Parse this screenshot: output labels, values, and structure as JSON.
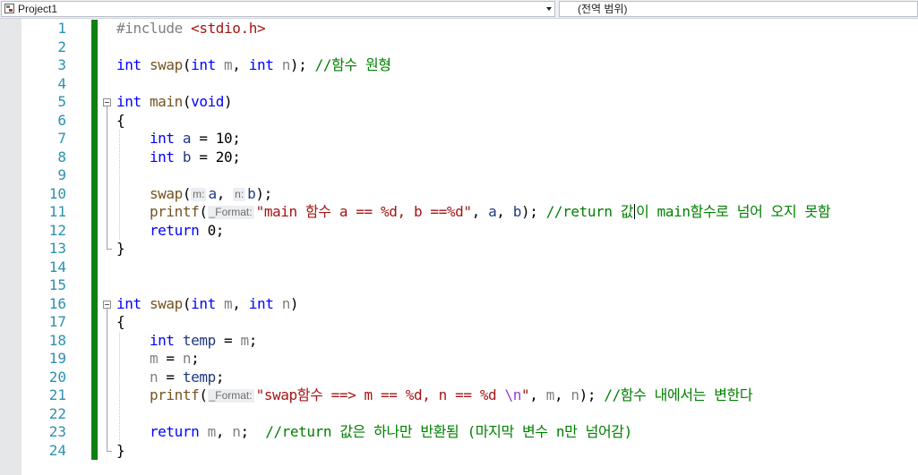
{
  "navbar": {
    "project": "Project1",
    "scope": "(전역 범위)"
  },
  "editor": {
    "lines": [
      {
        "n": "1",
        "tokens": [
          {
            "t": "#include ",
            "c": "pre"
          },
          {
            "t": "<stdio.h>",
            "c": "inc"
          }
        ]
      },
      {
        "n": "2",
        "tokens": []
      },
      {
        "n": "3",
        "tokens": [
          {
            "t": "int",
            "c": "kw"
          },
          {
            "t": " "
          },
          {
            "t": "swap",
            "c": "fn"
          },
          {
            "t": "("
          },
          {
            "t": "int",
            "c": "kw"
          },
          {
            "t": " "
          },
          {
            "t": "m",
            "c": "pm"
          },
          {
            "t": ", "
          },
          {
            "t": "int",
            "c": "kw"
          },
          {
            "t": " "
          },
          {
            "t": "n",
            "c": "pm"
          },
          {
            "t": "); "
          },
          {
            "t": "//함수 원형",
            "c": "cm"
          }
        ]
      },
      {
        "n": "4",
        "tokens": []
      },
      {
        "n": "5",
        "tokens": [
          {
            "t": "int",
            "c": "kw"
          },
          {
            "t": " "
          },
          {
            "t": "main",
            "c": "fn"
          },
          {
            "t": "("
          },
          {
            "t": "void",
            "c": "kw"
          },
          {
            "t": ")"
          }
        ]
      },
      {
        "n": "6",
        "tokens": [
          {
            "t": "{"
          }
        ]
      },
      {
        "n": "7",
        "tokens": [
          {
            "t": "    "
          },
          {
            "t": "int",
            "c": "kw"
          },
          {
            "t": " "
          },
          {
            "t": "a",
            "c": "lv"
          },
          {
            "t": " = 10;"
          }
        ]
      },
      {
        "n": "8",
        "tokens": [
          {
            "t": "    "
          },
          {
            "t": "int",
            "c": "kw"
          },
          {
            "t": " "
          },
          {
            "t": "b",
            "c": "lv"
          },
          {
            "t": " = 20;"
          }
        ]
      },
      {
        "n": "9",
        "tokens": []
      },
      {
        "n": "10",
        "tokens": [
          {
            "t": "    "
          },
          {
            "t": "swap",
            "c": "fn"
          },
          {
            "t": "("
          },
          {
            "hint": "m:"
          },
          {
            "t": "a",
            "c": "lv"
          },
          {
            "t": ", "
          },
          {
            "hint": "n:"
          },
          {
            "t": "b",
            "c": "lv"
          },
          {
            "t": ");"
          }
        ]
      },
      {
        "n": "11",
        "tokens": [
          {
            "t": "    "
          },
          {
            "t": "printf",
            "c": "fn"
          },
          {
            "t": "("
          },
          {
            "hint": "_Format:"
          },
          {
            "t": "\"main 함수 a == %d, b ==%d\"",
            "c": "str"
          },
          {
            "t": ", "
          },
          {
            "t": "a",
            "c": "lv"
          },
          {
            "t": ", "
          },
          {
            "t": "b",
            "c": "lv"
          },
          {
            "t": "); "
          },
          {
            "t": "//return 값",
            "c": "cm"
          },
          {
            "caret": true
          },
          {
            "t": "이 main함수로 넘어 오지 못함",
            "c": "cm"
          }
        ]
      },
      {
        "n": "12",
        "tokens": [
          {
            "t": "    "
          },
          {
            "t": "return",
            "c": "kw"
          },
          {
            "t": " 0;"
          }
        ]
      },
      {
        "n": "13",
        "tokens": [
          {
            "t": "}"
          }
        ]
      },
      {
        "n": "14",
        "tokens": []
      },
      {
        "n": "15",
        "tokens": []
      },
      {
        "n": "16",
        "tokens": [
          {
            "t": "int",
            "c": "kw"
          },
          {
            "t": " "
          },
          {
            "t": "swap",
            "c": "fn"
          },
          {
            "t": "("
          },
          {
            "t": "int",
            "c": "kw"
          },
          {
            "t": " "
          },
          {
            "t": "m",
            "c": "pm"
          },
          {
            "t": ", "
          },
          {
            "t": "int",
            "c": "kw"
          },
          {
            "t": " "
          },
          {
            "t": "n",
            "c": "pm"
          },
          {
            "t": ")"
          }
        ]
      },
      {
        "n": "17",
        "tokens": [
          {
            "t": "{"
          }
        ]
      },
      {
        "n": "18",
        "tokens": [
          {
            "t": "    "
          },
          {
            "t": "int",
            "c": "kw"
          },
          {
            "t": " "
          },
          {
            "t": "temp",
            "c": "lv"
          },
          {
            "t": " = "
          },
          {
            "t": "m",
            "c": "pm"
          },
          {
            "t": ";"
          }
        ]
      },
      {
        "n": "19",
        "tokens": [
          {
            "t": "    "
          },
          {
            "t": "m",
            "c": "pm"
          },
          {
            "t": " = "
          },
          {
            "t": "n",
            "c": "pm"
          },
          {
            "t": ";"
          }
        ]
      },
      {
        "n": "20",
        "tokens": [
          {
            "t": "    "
          },
          {
            "t": "n",
            "c": "pm"
          },
          {
            "t": " = "
          },
          {
            "t": "temp",
            "c": "lv"
          },
          {
            "t": ";"
          }
        ]
      },
      {
        "n": "21",
        "tokens": [
          {
            "t": "    "
          },
          {
            "t": "printf",
            "c": "fn"
          },
          {
            "t": "("
          },
          {
            "hint": "_Format:"
          },
          {
            "t": "\"swap함수 ==> m == %d, n == %d ",
            "c": "str"
          },
          {
            "t": "\\n",
            "c": "esc"
          },
          {
            "t": "\"",
            "c": "str"
          },
          {
            "t": ", "
          },
          {
            "t": "m",
            "c": "pm"
          },
          {
            "t": ", "
          },
          {
            "t": "n",
            "c": "pm"
          },
          {
            "t": "); "
          },
          {
            "t": "//함수 내에서는 변한다",
            "c": "cm"
          }
        ]
      },
      {
        "n": "22",
        "tokens": []
      },
      {
        "n": "23",
        "tokens": [
          {
            "t": "    "
          },
          {
            "t": "return",
            "c": "kw"
          },
          {
            "t": " "
          },
          {
            "t": "m",
            "c": "pm"
          },
          {
            "t": ", "
          },
          {
            "t": "n",
            "c": "pm"
          },
          {
            "t": ";  "
          },
          {
            "t": "//return 값은 하나만 반환됨 (마지막 변수 n만 넘어감)",
            "c": "cm"
          }
        ]
      },
      {
        "n": "24",
        "tokens": [
          {
            "t": "}"
          }
        ]
      }
    ]
  }
}
